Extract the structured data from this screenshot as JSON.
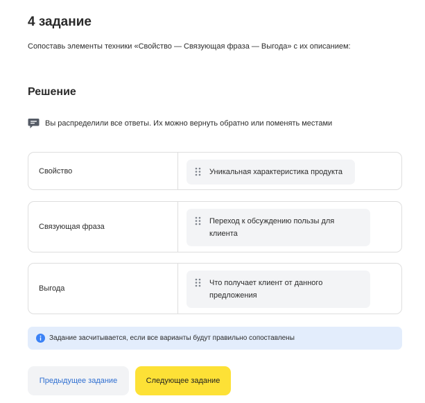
{
  "task": {
    "title": "4 задание",
    "description": "Сопоставь элементы техники «Свойство — Связующая фраза — Выгода» с их описанием:"
  },
  "solution": {
    "title": "Решение",
    "hint": "Вы распределили все ответы. Их можно вернуть обратно или поменять местами",
    "hint_icon": "chat-bubble-icon"
  },
  "matches": [
    {
      "label": "Свойство",
      "answer": "Уникальная характеристика продукта"
    },
    {
      "label": "Связующая фраза",
      "answer": "Переход к обсуждению пользы для клиента"
    },
    {
      "label": "Выгода",
      "answer": "Что получает клиент от данного предложения"
    }
  ],
  "info": {
    "icon": "info-icon",
    "text": "Задание засчитывается, если все варианты будут правильно сопоставлены"
  },
  "buttons": {
    "prev_label": "Предыдущее задание",
    "next_label": "Следующее задание"
  },
  "colors": {
    "accent_yellow": "#fde136",
    "link_blue": "#2f6fd1",
    "info_bg": "#e3edfc",
    "info_icon": "#3b82f6",
    "chip_bg": "#f3f4f6",
    "border": "#dedede"
  }
}
